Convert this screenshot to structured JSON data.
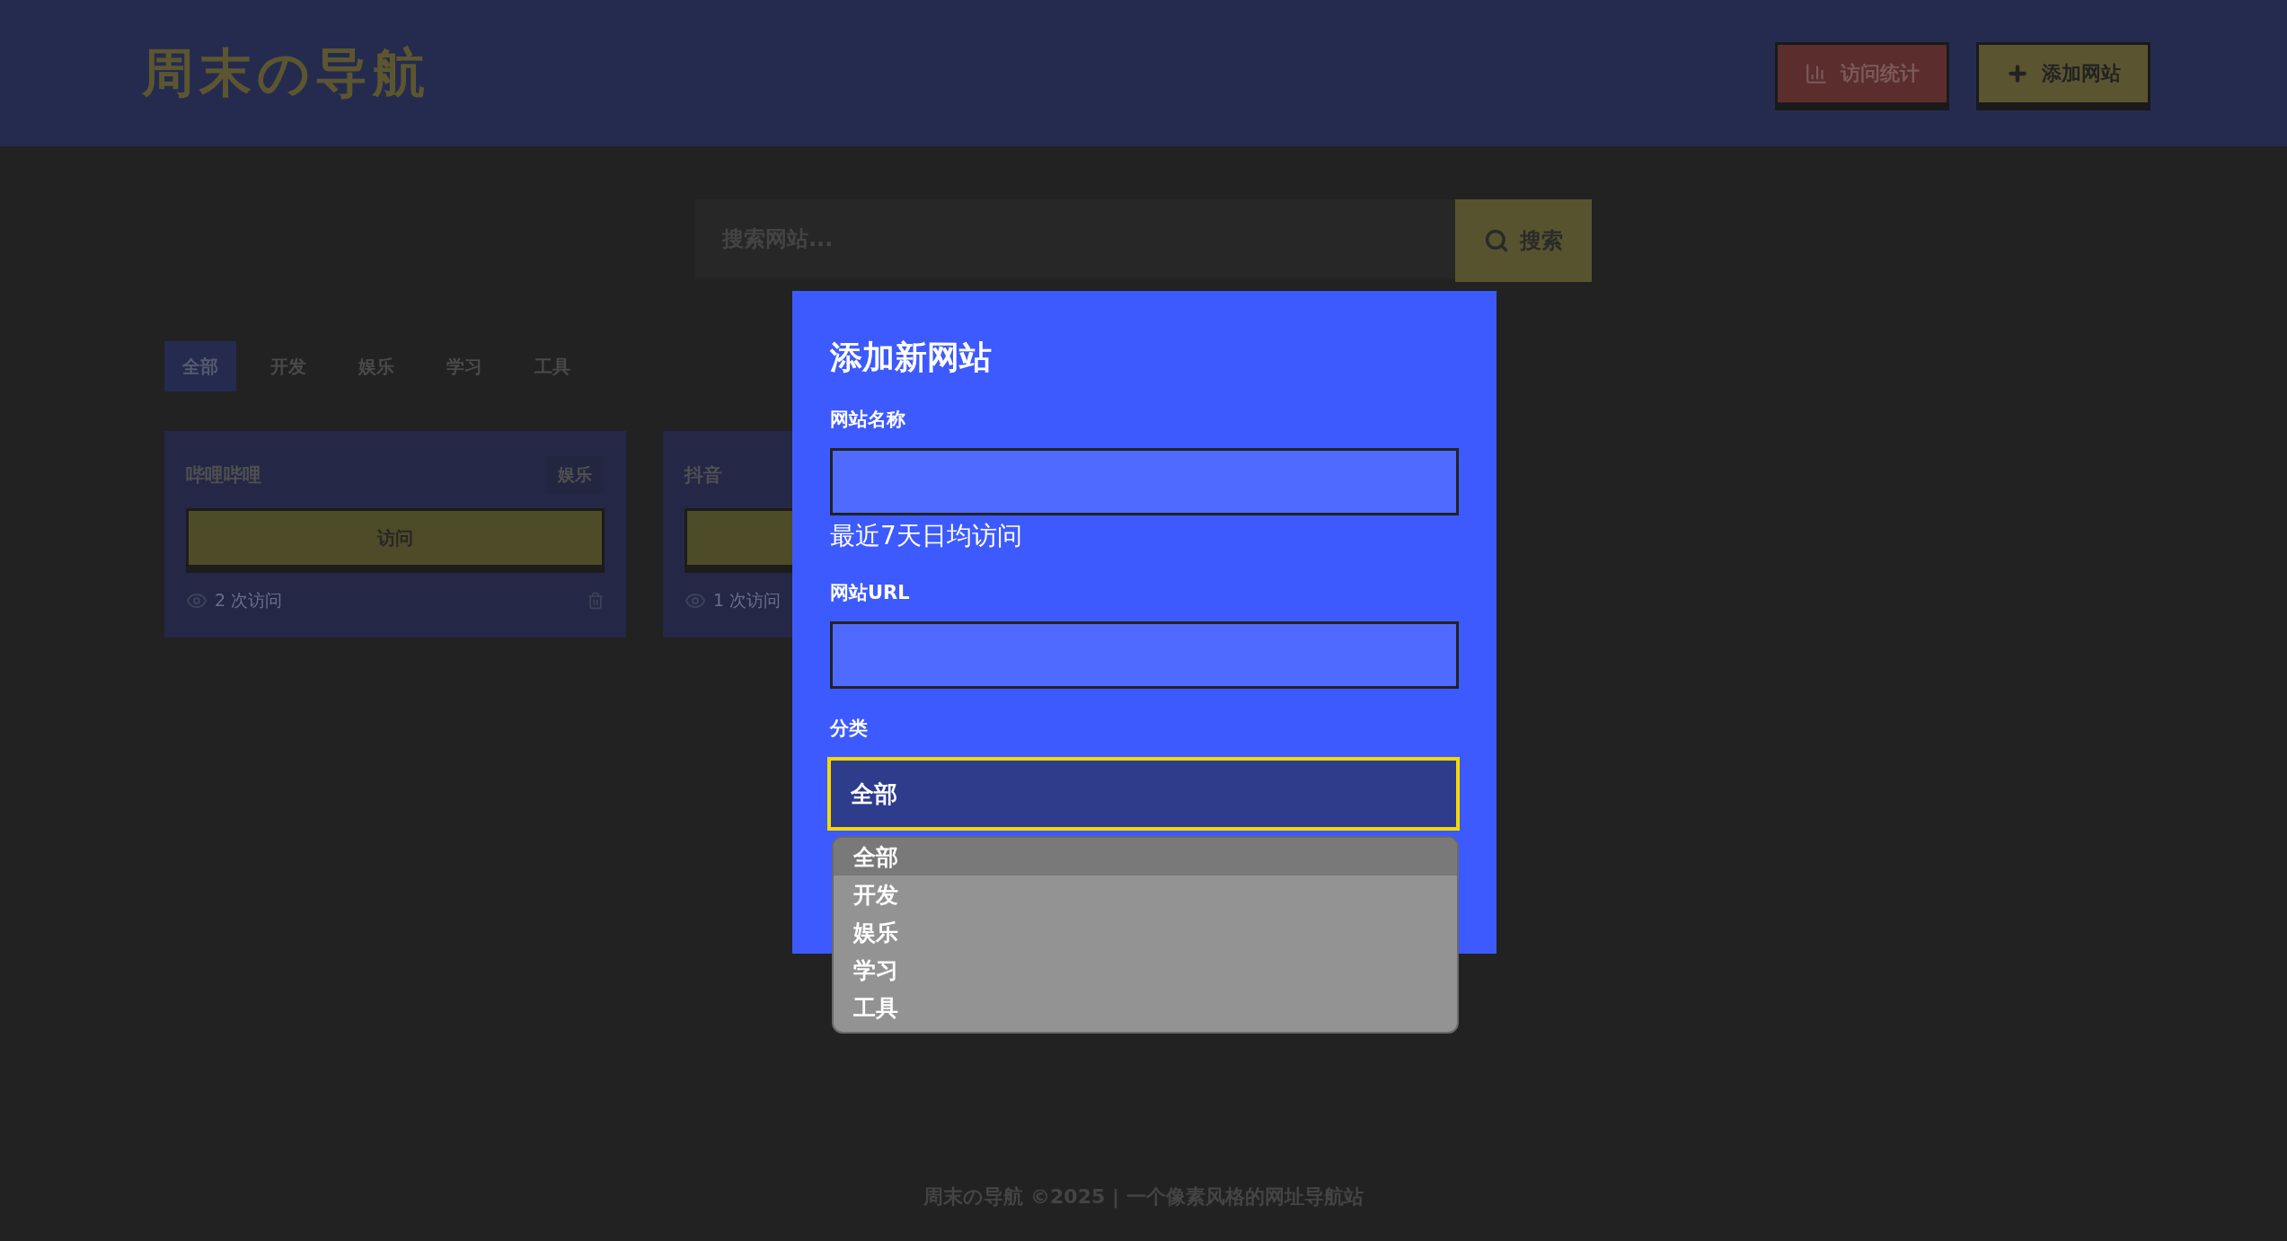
{
  "header": {
    "logo": "周末の导航",
    "buttons": [
      {
        "label": "访问统计",
        "kind": "stats"
      },
      {
        "label": "添加网站",
        "kind": "add"
      }
    ]
  },
  "search": {
    "placeholder": "搜索网站...",
    "button": "搜索"
  },
  "tabs": [
    {
      "label": "全部",
      "selected": true
    },
    {
      "label": "开发",
      "selected": false
    },
    {
      "label": "娱乐",
      "selected": false
    },
    {
      "label": "学习",
      "selected": false
    },
    {
      "label": "工具",
      "selected": false
    }
  ],
  "cards": [
    {
      "name": "哔哩哔哩",
      "tag": "娱乐",
      "button": "访问",
      "visits": "2 次访问",
      "delete_icon": true
    },
    {
      "name": "抖音",
      "visits": "1 次访问"
    }
  ],
  "modal": {
    "title": "添加新网站",
    "fields": [
      {
        "label": "网站名称",
        "hint": "最近7天日均访问"
      },
      {
        "label": "网站URL"
      }
    ],
    "category": {
      "label": "分类",
      "value": "全部",
      "options": [
        {
          "label": "全部",
          "selected": true
        },
        {
          "label": "开发",
          "selected": false
        },
        {
          "label": "娱乐",
          "selected": false
        },
        {
          "label": "学习",
          "selected": false
        },
        {
          "label": "工具",
          "selected": false
        }
      ]
    }
  },
  "footer": "周末の导航 ©2025 | 一个像素风格的网址导航站"
}
